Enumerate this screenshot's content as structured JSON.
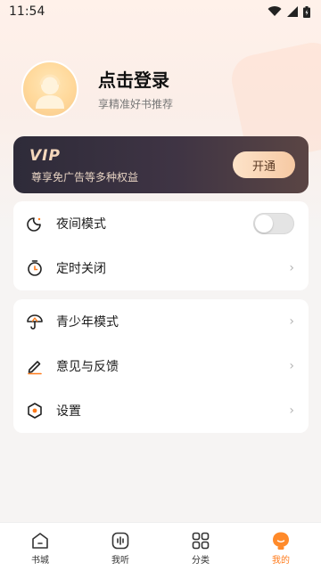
{
  "status_bar": {
    "time": "11:54"
  },
  "profile": {
    "title": "点击登录",
    "subtitle": "享精准好书推荐"
  },
  "vip": {
    "logo": "VIP",
    "description": "尊享免广告等多种权益",
    "button": "开通"
  },
  "settings_group_1": [
    {
      "label": "夜间模式",
      "icon": "moon-icon",
      "control": "toggle",
      "toggle_on": false
    },
    {
      "label": "定时关闭",
      "icon": "timer-icon",
      "control": "chevron"
    }
  ],
  "settings_group_2": [
    {
      "label": "青少年模式",
      "icon": "umbrella-icon",
      "control": "chevron"
    },
    {
      "label": "意见与反馈",
      "icon": "pen-icon",
      "control": "chevron"
    },
    {
      "label": "设置",
      "icon": "settings-icon",
      "control": "chevron"
    }
  ],
  "chevron_glyph": "›",
  "bottom_nav": [
    {
      "label": "书城",
      "icon": "home-icon",
      "active": false
    },
    {
      "label": "我听",
      "icon": "audio-icon",
      "active": false
    },
    {
      "label": "分类",
      "icon": "grid-icon",
      "active": false
    },
    {
      "label": "我的",
      "icon": "profile-icon",
      "active": true
    }
  ],
  "colors": {
    "accent": "#ff7a1a",
    "vip_gold": "#f5d8bc",
    "vip_bg": "#2e2b39",
    "page_bg": "#f6f4f3"
  }
}
